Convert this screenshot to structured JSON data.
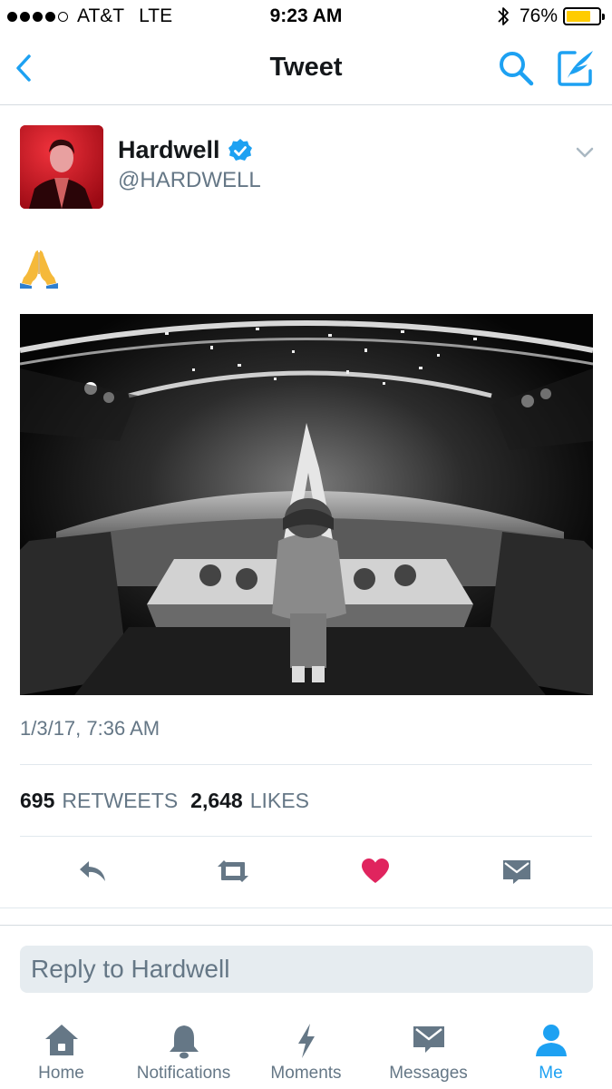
{
  "status_bar": {
    "carrier": "AT&T",
    "network": "LTE",
    "time": "9:23 AM",
    "battery_percent": "76%",
    "battery_level": 0.76,
    "signal_bars_filled": 4,
    "signal_bars_total": 5
  },
  "nav": {
    "title": "Tweet",
    "back_icon": "chevron-left-icon",
    "search_icon": "search-icon",
    "compose_icon": "compose-icon"
  },
  "tweet": {
    "author_name": "Hardwell",
    "author_handle": "@HARDWELL",
    "verified": true,
    "text_emoji": "folded-hands",
    "timestamp": "1/3/17, 7:36 AM",
    "retweets_count": "695",
    "retweets_label": "RETWEETS",
    "likes_count": "2,648",
    "likes_label": "LIKES",
    "liked": true
  },
  "colors": {
    "accent": "#1da1f2",
    "like": "#e0245e",
    "muted": "#657786",
    "battery": "#ffcc00"
  },
  "reply": {
    "placeholder": "Reply to Hardwell"
  },
  "tabs": [
    {
      "label": "Home",
      "icon": "home-icon",
      "active": false
    },
    {
      "label": "Notifications",
      "icon": "bell-icon",
      "active": false
    },
    {
      "label": "Moments",
      "icon": "lightning-icon",
      "active": false
    },
    {
      "label": "Messages",
      "icon": "envelope-icon",
      "active": false
    },
    {
      "label": "Me",
      "icon": "person-icon",
      "active": true
    }
  ]
}
